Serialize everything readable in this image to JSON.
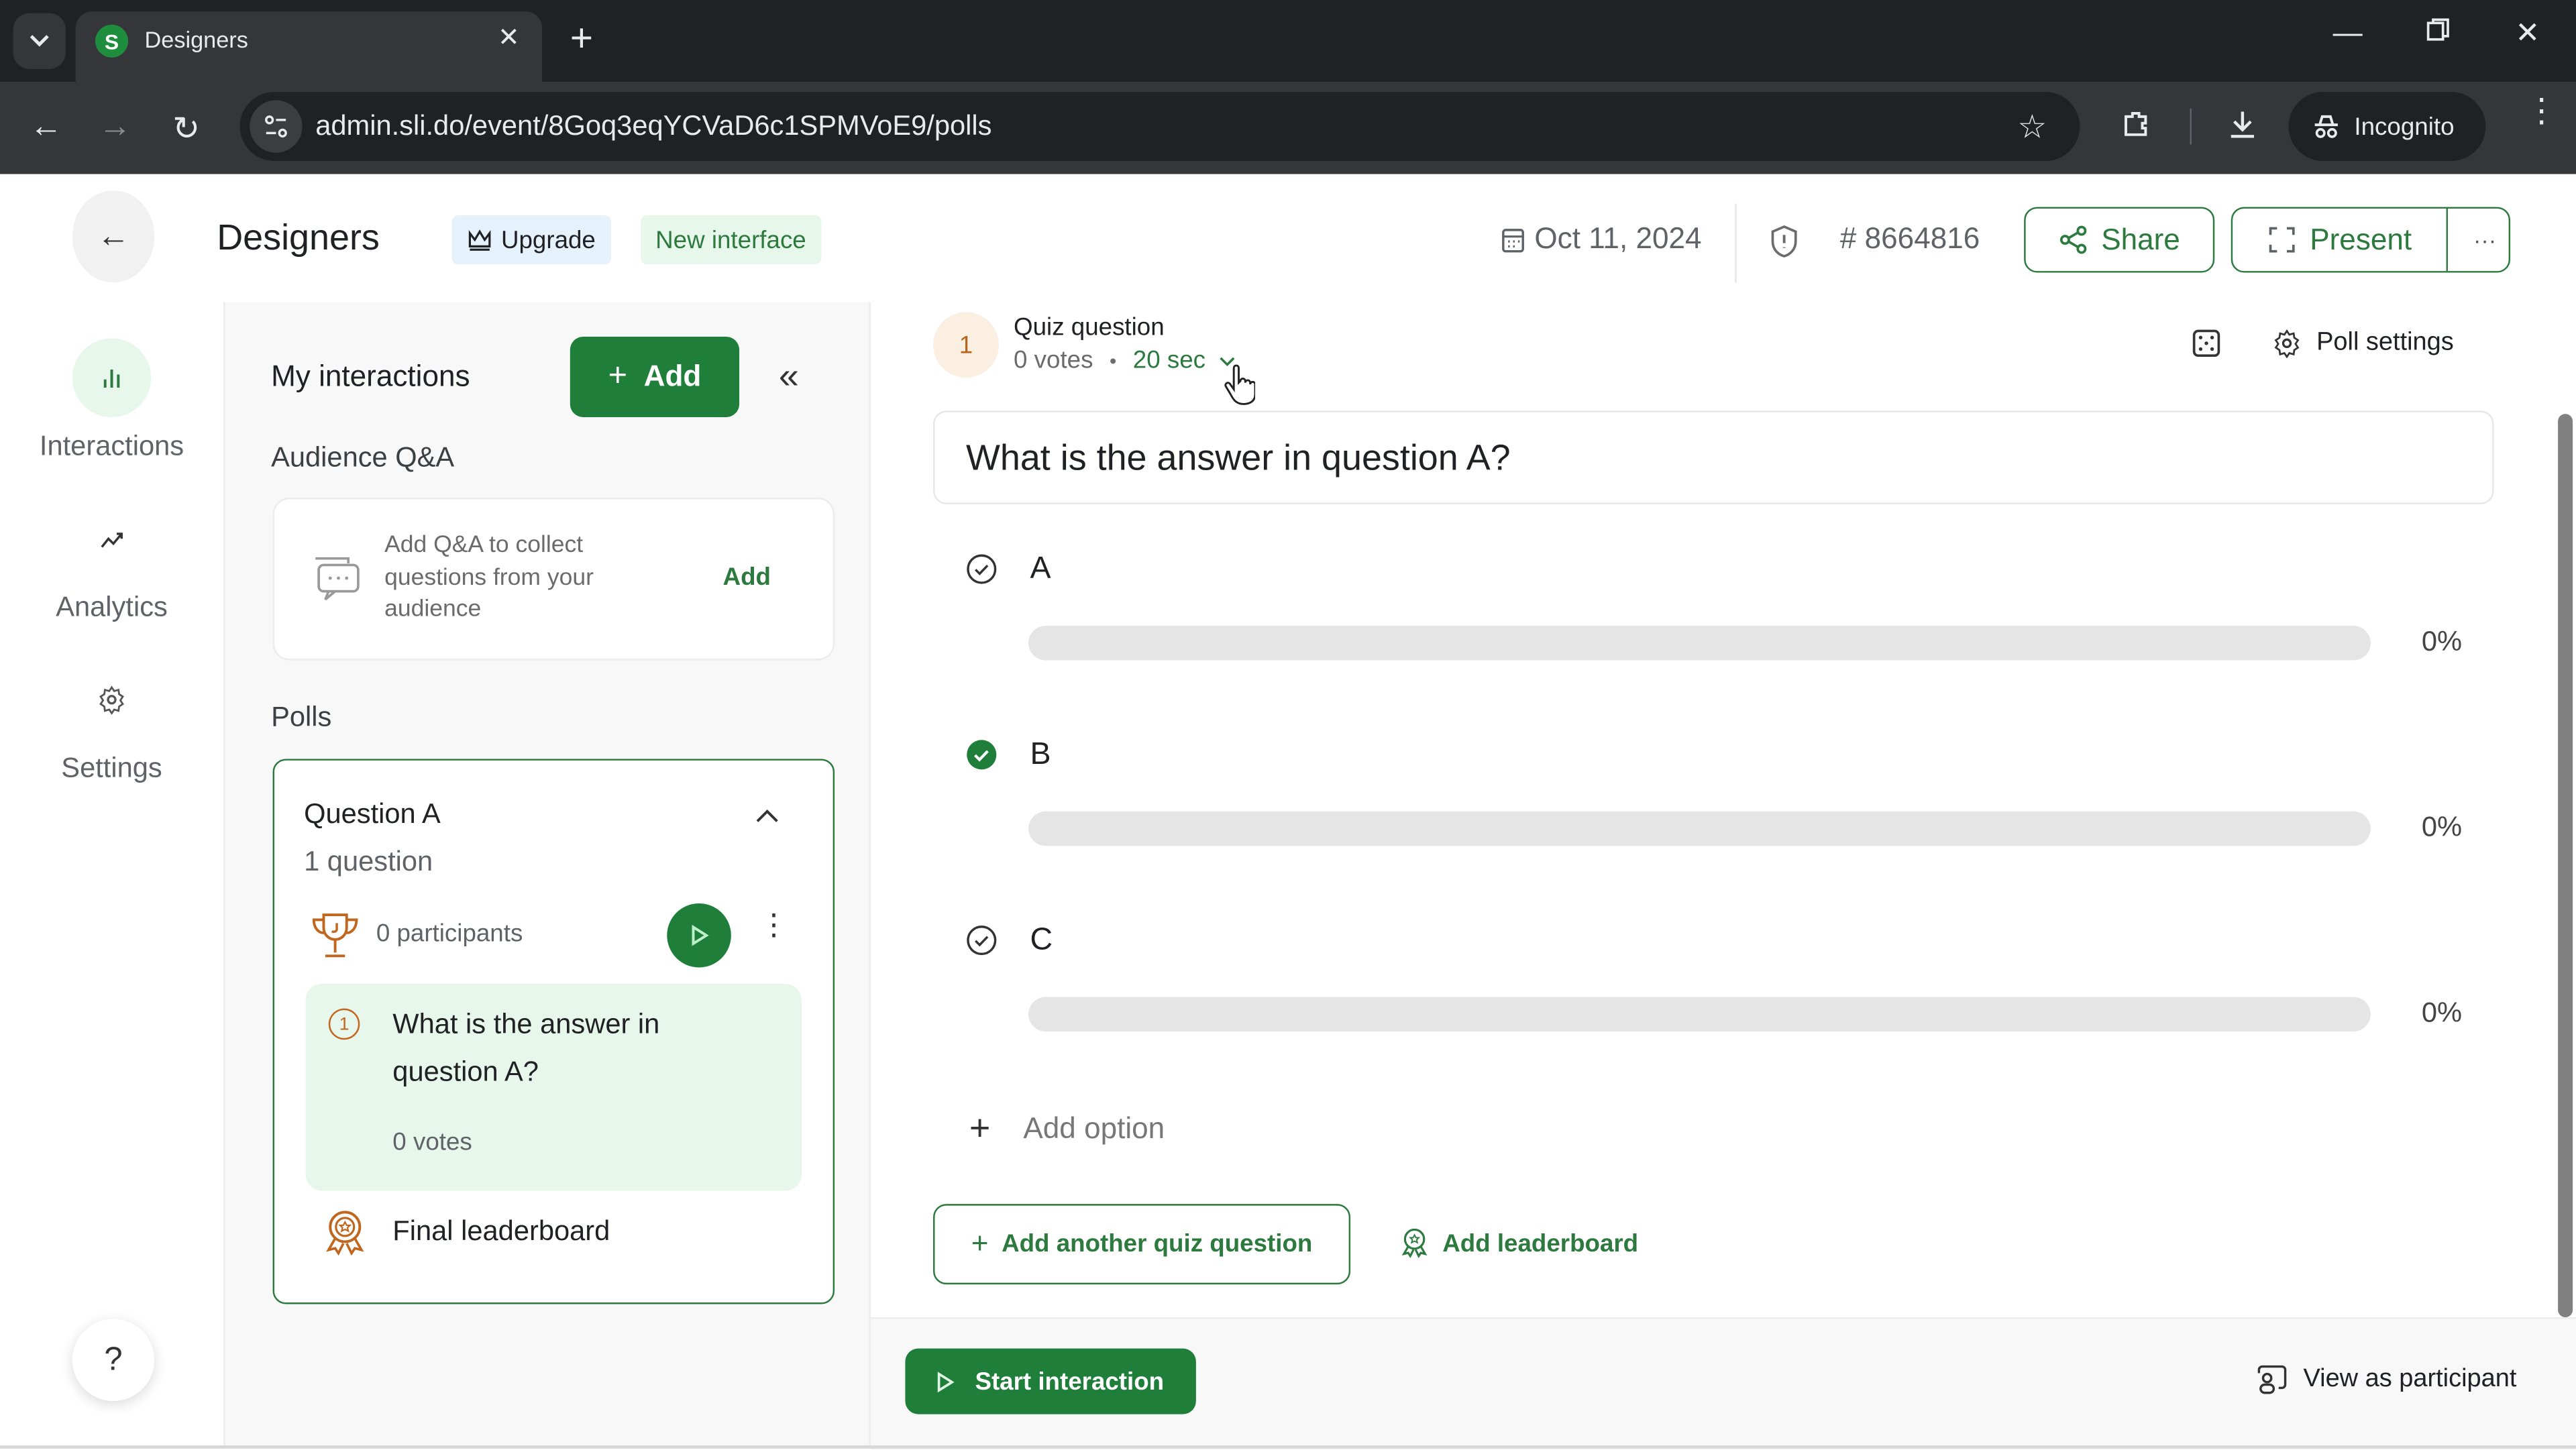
{
  "browser": {
    "tab_title": "Designers",
    "tab_favicon_letter": "S",
    "url": "admin.sli.do/event/8Goq3eqYCVaD6c1SPMVoE9/polls",
    "profile_label": "Incognito"
  },
  "header": {
    "title": "Designers",
    "upgrade_label": "Upgrade",
    "new_interface_label": "New interface",
    "date": "Oct 11, 2024",
    "event_code": "# 8664816",
    "share_label": "Share",
    "present_label": "Present",
    "more_label": "···"
  },
  "rail": {
    "items": [
      {
        "label": "Interactions",
        "icon": "bar-chart-icon",
        "active": true
      },
      {
        "label": "Analytics",
        "icon": "trend-icon",
        "active": false
      },
      {
        "label": "Settings",
        "icon": "gear-icon",
        "active": false
      }
    ],
    "help_label": "?"
  },
  "panel": {
    "title": "My interactions",
    "add_label": "Add",
    "qa_section": "Audience Q&A",
    "qa_text": "Add Q&A to collect questions from your audience",
    "qa_add_label": "Add",
    "polls_section": "Polls",
    "poll": {
      "title": "Question A",
      "count": "1 question",
      "participants": "0 participants",
      "question_number": "1",
      "question_text": "What is the answer in question A?",
      "question_votes": "0 votes",
      "leaderboard": "Final leaderboard"
    }
  },
  "main": {
    "question_number": "1",
    "question_type": "Quiz question",
    "votes": "0 votes",
    "separator": "•",
    "timer": "20 sec",
    "poll_settings_label": "Poll settings",
    "question_text": "What is the answer in question A?",
    "options": [
      {
        "label": "A",
        "correct": false,
        "percent": 0,
        "percent_label": "0%"
      },
      {
        "label": "B",
        "correct": true,
        "percent": 0,
        "percent_label": "0%"
      },
      {
        "label": "C",
        "correct": false,
        "percent": 0,
        "percent_label": "0%"
      }
    ],
    "add_option_label": "Add option",
    "add_quiz_label": "Add another quiz question",
    "add_leaderboard_label": "Add leaderboard"
  },
  "footer": {
    "start_label": "Start interaction",
    "view_participant_label": "View as participant"
  },
  "colors": {
    "brand_green": "#1e7e3a",
    "text_green": "#2d7a3f",
    "orange_accent": "#c0661f"
  }
}
